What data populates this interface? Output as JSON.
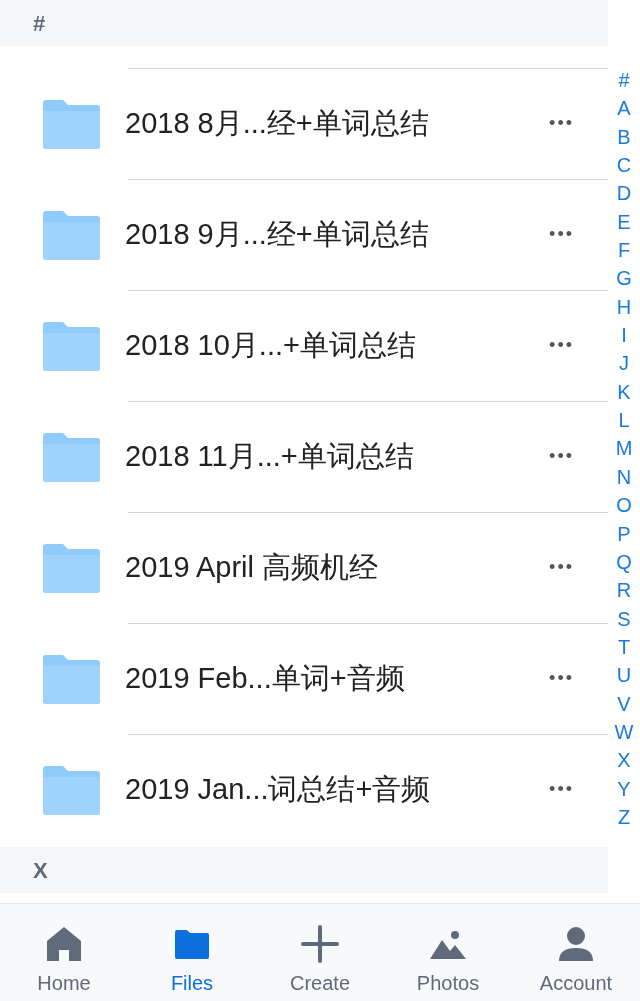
{
  "sections": [
    {
      "header": "#",
      "folders": [
        {
          "name": "2018 8月...经+单词总结",
          "menu": "•••"
        },
        {
          "name": "2018 9月...经+单词总结",
          "menu": "•••"
        },
        {
          "name": "2018 10月...+单词总结",
          "menu": "•••"
        },
        {
          "name": "2018 11月...+单词总结",
          "menu": "•••"
        },
        {
          "name": "2019 April 高频机经",
          "menu": "•••"
        },
        {
          "name": "2019 Feb...单词+音频",
          "menu": "•••"
        },
        {
          "name": "2019 Jan...词总结+音频",
          "menu": "•••"
        }
      ]
    },
    {
      "header": "X"
    }
  ],
  "index": [
    "#",
    "A",
    "B",
    "C",
    "D",
    "E",
    "F",
    "G",
    "H",
    "I",
    "J",
    "K",
    "L",
    "M",
    "N",
    "O",
    "P",
    "Q",
    "R",
    "S",
    "T",
    "U",
    "V",
    "W",
    "X",
    "Y",
    "Z"
  ],
  "tabs": [
    {
      "kind": "home",
      "label": "Home",
      "selected": false
    },
    {
      "kind": "files",
      "label": "Files",
      "selected": true
    },
    {
      "kind": "create",
      "label": "Create",
      "selected": false
    },
    {
      "kind": "photos",
      "label": "Photos",
      "selected": false
    },
    {
      "kind": "account",
      "label": "Account",
      "selected": false
    }
  ]
}
